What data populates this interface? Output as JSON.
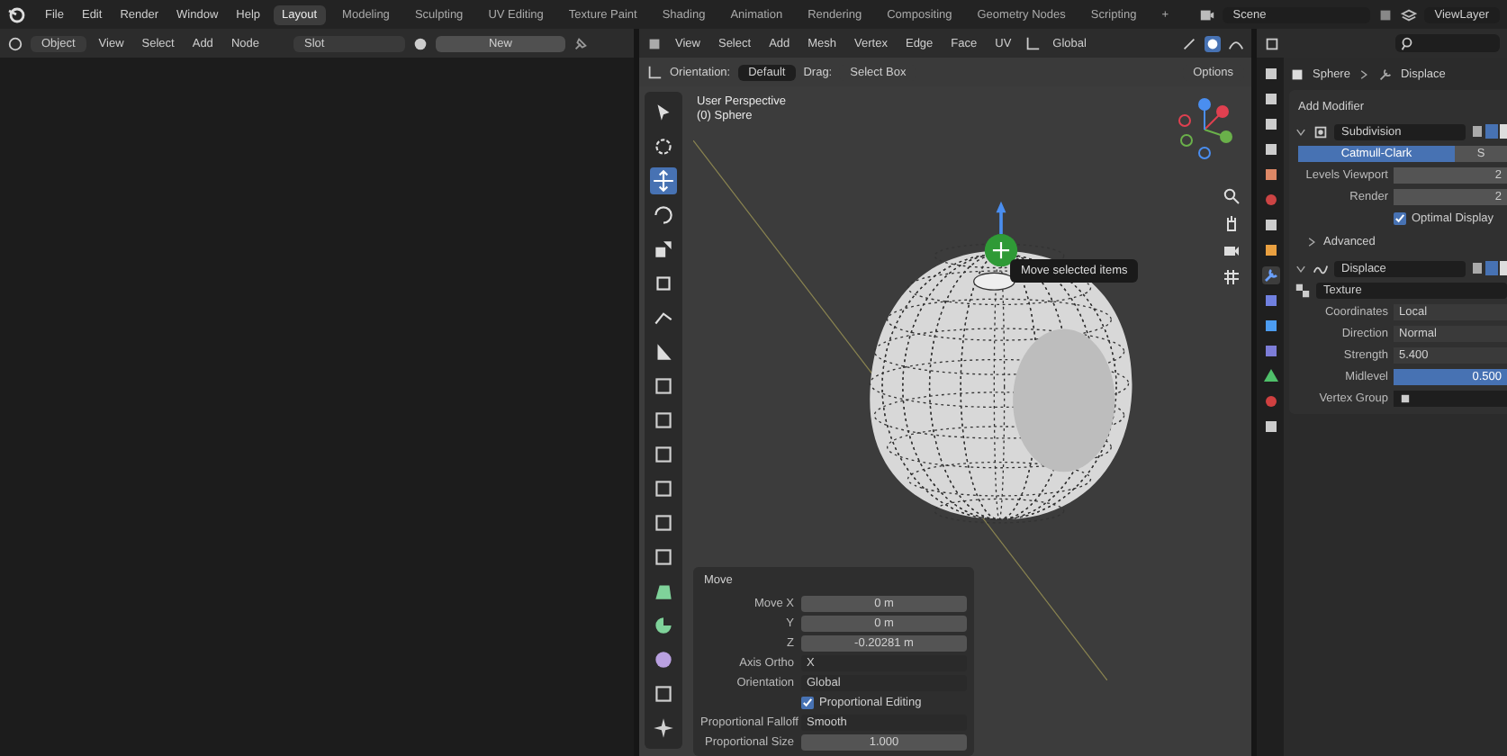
{
  "menu": [
    "File",
    "Edit",
    "Render",
    "Window",
    "Help"
  ],
  "workspaces": [
    {
      "label": "Layout",
      "selected": true
    },
    {
      "label": "Modeling",
      "selected": false
    },
    {
      "label": "Sculpting",
      "selected": false
    },
    {
      "label": "UV Editing",
      "selected": false
    },
    {
      "label": "Texture Paint",
      "selected": false
    },
    {
      "label": "Shading",
      "selected": false
    },
    {
      "label": "Animation",
      "selected": false
    },
    {
      "label": "Rendering",
      "selected": false
    },
    {
      "label": "Compositing",
      "selected": false
    },
    {
      "label": "Geometry Nodes",
      "selected": false
    },
    {
      "label": "Scripting",
      "selected": false
    }
  ],
  "add_workspace": "+",
  "scene": "Scene",
  "view_layer": "ViewLayer",
  "node_editor": {
    "mode": "Object",
    "menus": [
      "View",
      "Select",
      "Add",
      "Node"
    ],
    "slot": "Slot",
    "material": "New"
  },
  "viewport": {
    "menus": [
      "View",
      "Select",
      "Add",
      "Mesh",
      "Vertex",
      "Edge",
      "Face",
      "UV"
    ],
    "transform": "Global",
    "orientation_label": "Orientation:",
    "orientation": "Default",
    "drag_label": "Drag:",
    "drag": "Select Box",
    "options": "Options",
    "view_name": "User Perspective",
    "object_name": "(0) Sphere",
    "tooltip": "Move selected items",
    "tools": [
      {
        "kind": "cursor",
        "selected": false
      },
      {
        "kind": "cursor3d",
        "selected": false
      },
      {
        "kind": "move",
        "selected": true
      },
      {
        "kind": "rotate",
        "selected": false
      },
      {
        "kind": "scale",
        "selected": false
      },
      {
        "kind": "transform",
        "selected": false
      },
      {
        "kind": "annotate",
        "selected": false
      },
      {
        "kind": "measure",
        "selected": false
      },
      {
        "kind": "cube",
        "selected": false
      },
      {
        "kind": "cube",
        "selected": false
      },
      {
        "kind": "cube",
        "selected": false
      },
      {
        "kind": "cube",
        "selected": false
      },
      {
        "kind": "cube",
        "selected": false
      },
      {
        "kind": "cube",
        "selected": false
      },
      {
        "kind": "poly",
        "selected": false
      },
      {
        "kind": "spin",
        "selected": false
      },
      {
        "kind": "sphere",
        "selected": false
      },
      {
        "kind": "cube",
        "selected": false
      },
      {
        "kind": "star",
        "selected": false
      }
    ]
  },
  "move_panel": {
    "title": "Move",
    "fields": [
      {
        "kind": "number",
        "label": "Move X",
        "value": "0 m"
      },
      {
        "kind": "number",
        "label": "Y",
        "value": "0 m"
      },
      {
        "kind": "number",
        "label": "Z",
        "value": "-0.20281 m"
      },
      {
        "kind": "dropdown",
        "label": "Axis Ortho",
        "value": "X"
      },
      {
        "kind": "dropdown",
        "label": "Orientation",
        "value": "Global"
      },
      {
        "kind": "checkbox",
        "label": "Proportional Editing",
        "checked": true
      },
      {
        "kind": "dropdown",
        "label": "Proportional Falloff",
        "value": "Smooth"
      },
      {
        "kind": "number",
        "label": "Proportional Size",
        "value": "1.000"
      }
    ]
  },
  "properties": {
    "tabs": [
      {
        "kind": "tool",
        "selected": false
      },
      {
        "kind": "render",
        "selected": false
      },
      {
        "kind": "output",
        "selected": false
      },
      {
        "kind": "view",
        "selected": false
      },
      {
        "kind": "scene",
        "selected": false
      },
      {
        "kind": "world",
        "selected": false
      },
      {
        "kind": "collection",
        "selected": false
      },
      {
        "kind": "object",
        "selected": false
      },
      {
        "kind": "modifier",
        "selected": true
      },
      {
        "kind": "particles",
        "selected": false
      },
      {
        "kind": "physics",
        "selected": false
      },
      {
        "kind": "constraints",
        "selected": false
      },
      {
        "kind": "data",
        "selected": false
      },
      {
        "kind": "material",
        "selected": false
      },
      {
        "kind": "texture",
        "selected": false
      }
    ],
    "object": "Sphere",
    "modifier": "Displace",
    "add_modifier": "Add Modifier",
    "subdivision": {
      "name": "Subdivision",
      "expanded": true,
      "methods": [
        {
          "label": "Catmull-Clark",
          "selected": true
        },
        {
          "label": "S",
          "selected": false
        }
      ],
      "rows": [
        {
          "label": "Levels Viewport",
          "value": "2"
        },
        {
          "label": "Render",
          "value": "2"
        }
      ],
      "optimal_display": {
        "label": "Optimal Display",
        "checked": true
      },
      "advanced": {
        "label": "Advanced",
        "expanded": false
      }
    },
    "displace": {
      "name": "Displace",
      "expanded": true,
      "texture": "Texture",
      "rows": [
        {
          "label": "Coordinates",
          "value": "Local",
          "active": false
        },
        {
          "label": "Direction",
          "value": "Normal",
          "active": false
        },
        {
          "label": "Strength",
          "value": "5.400",
          "active": false
        },
        {
          "label": "Midlevel",
          "value": "0.500",
          "active": true
        }
      ],
      "vertex_group": "Vertex Group"
    }
  }
}
